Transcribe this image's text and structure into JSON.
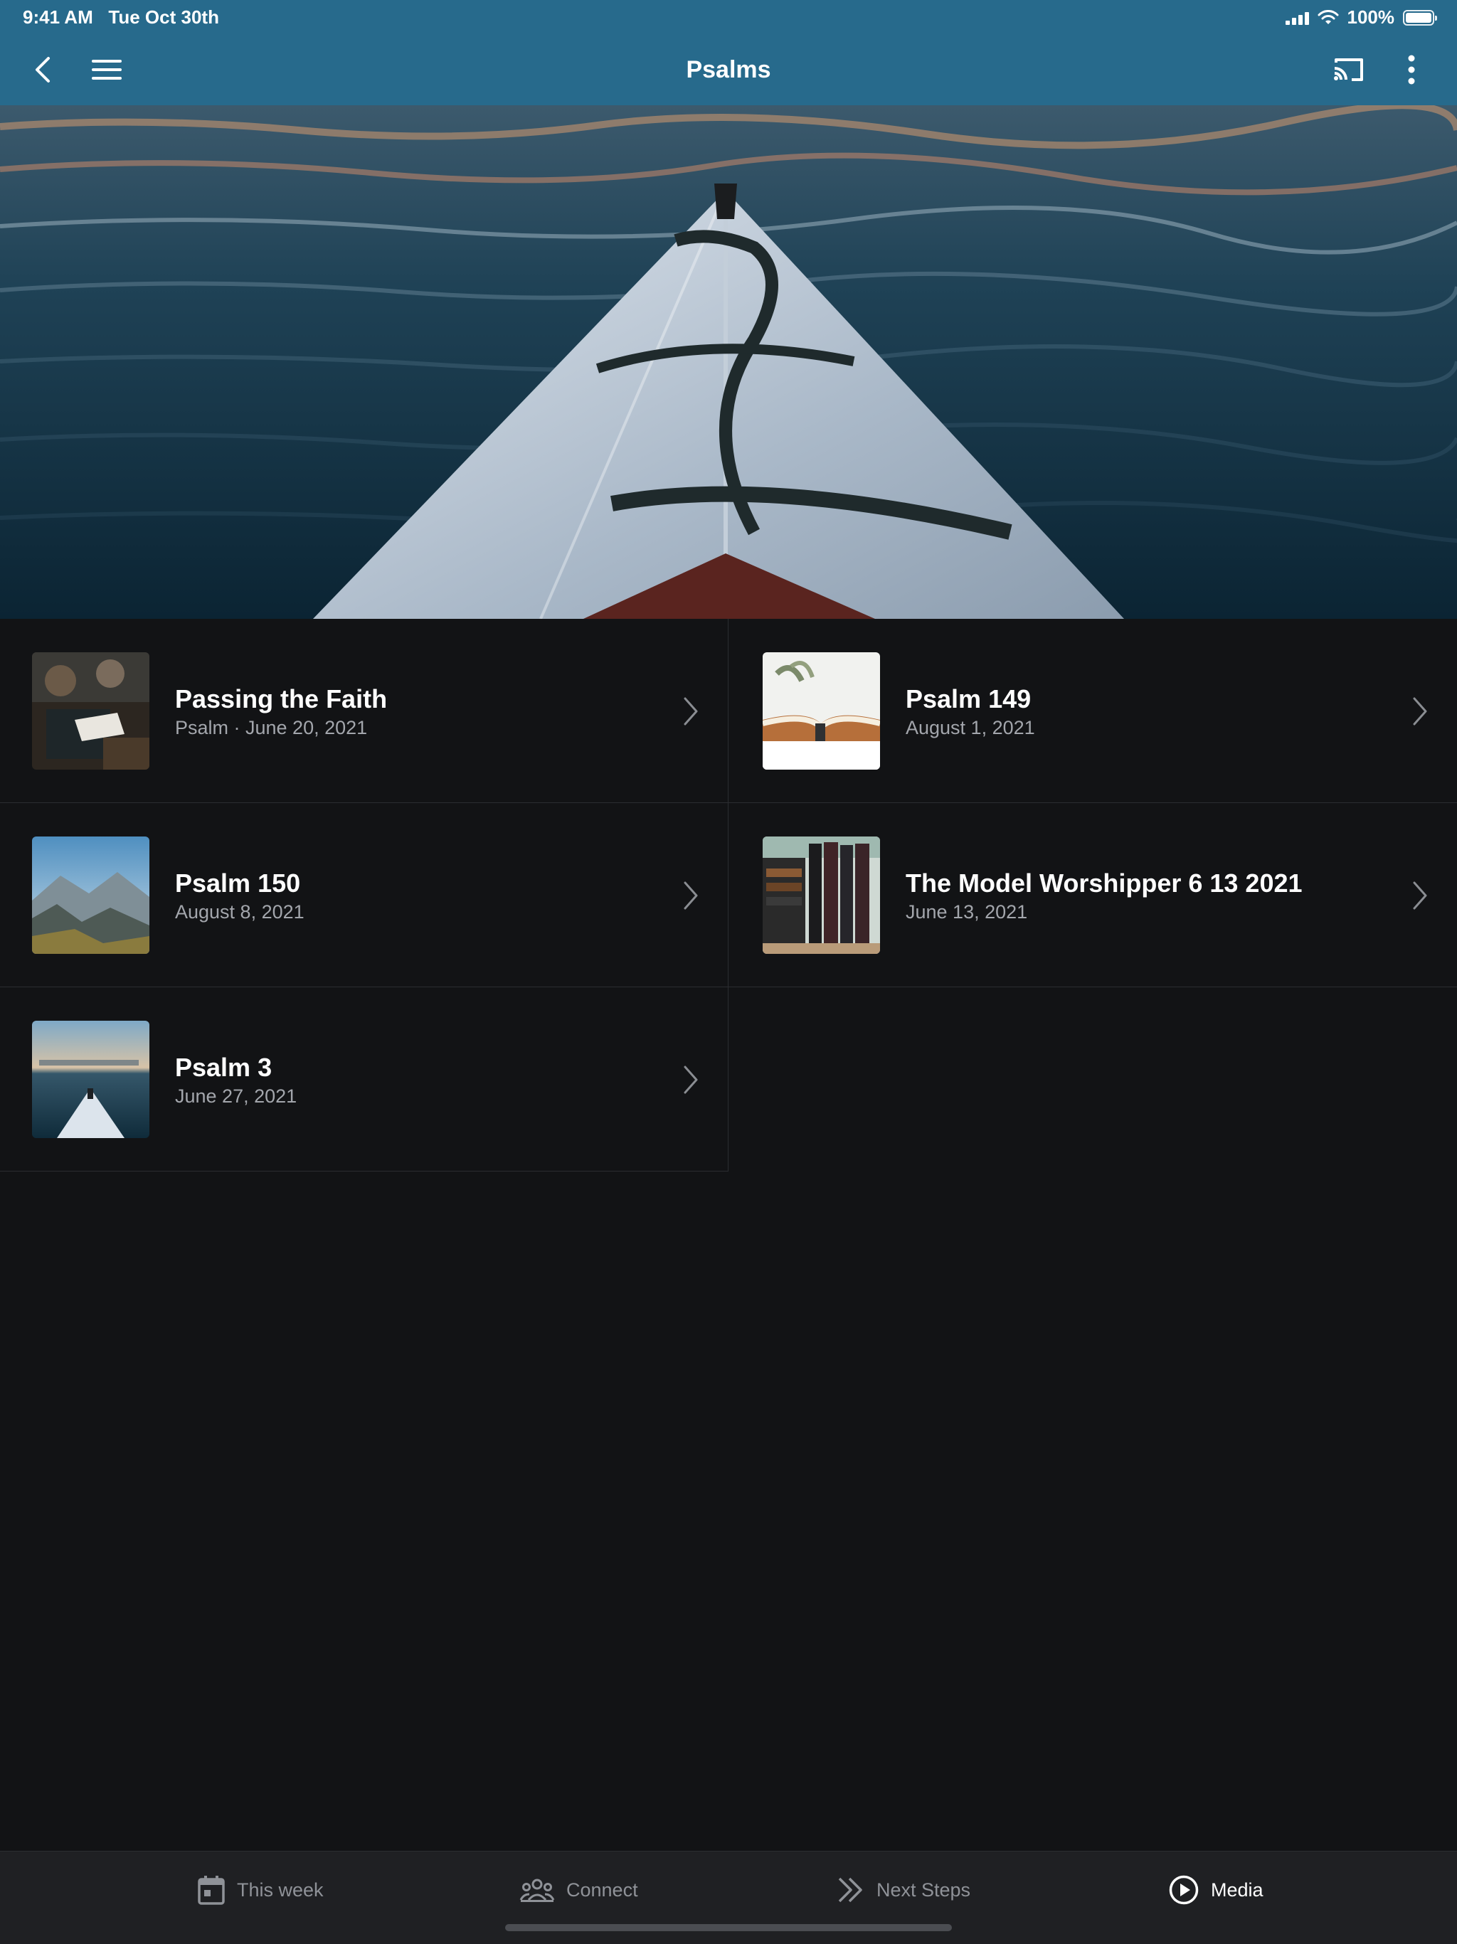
{
  "status_bar": {
    "time": "9:41 AM",
    "date": "Tue Oct 30th",
    "battery": "100%"
  },
  "nav": {
    "title": "Psalms",
    "icons": [
      "back-icon",
      "menu-icon",
      "cast-icon",
      "more-vertical-icon"
    ]
  },
  "hero": {
    "icon": "kayak-hero-image"
  },
  "items": [
    {
      "title": "Passing the Faith",
      "subtitle": "Psalm · June 20, 2021"
    },
    {
      "title": "Psalm 149",
      "subtitle": "August 1, 2021"
    },
    {
      "title": "Psalm 150",
      "subtitle": "August 8, 2021"
    },
    {
      "title": "The Model Worshipper 6 13 2021",
      "subtitle": "June 13, 2021"
    },
    {
      "title": "Psalm 3",
      "subtitle": "June 27, 2021"
    }
  ],
  "tabs": [
    {
      "label": "This week",
      "icon": "calendar-icon",
      "active": false
    },
    {
      "label": "Connect",
      "icon": "people-icon",
      "active": false
    },
    {
      "label": "Next Steps",
      "icon": "double-chevron-icon",
      "active": false
    },
    {
      "label": "Media",
      "icon": "play-circle-icon",
      "active": true
    }
  ],
  "colors": {
    "header": "#276a8c",
    "background": "#121315",
    "tabbar": "#1f2023",
    "muted_text": "#a3a6ac"
  }
}
